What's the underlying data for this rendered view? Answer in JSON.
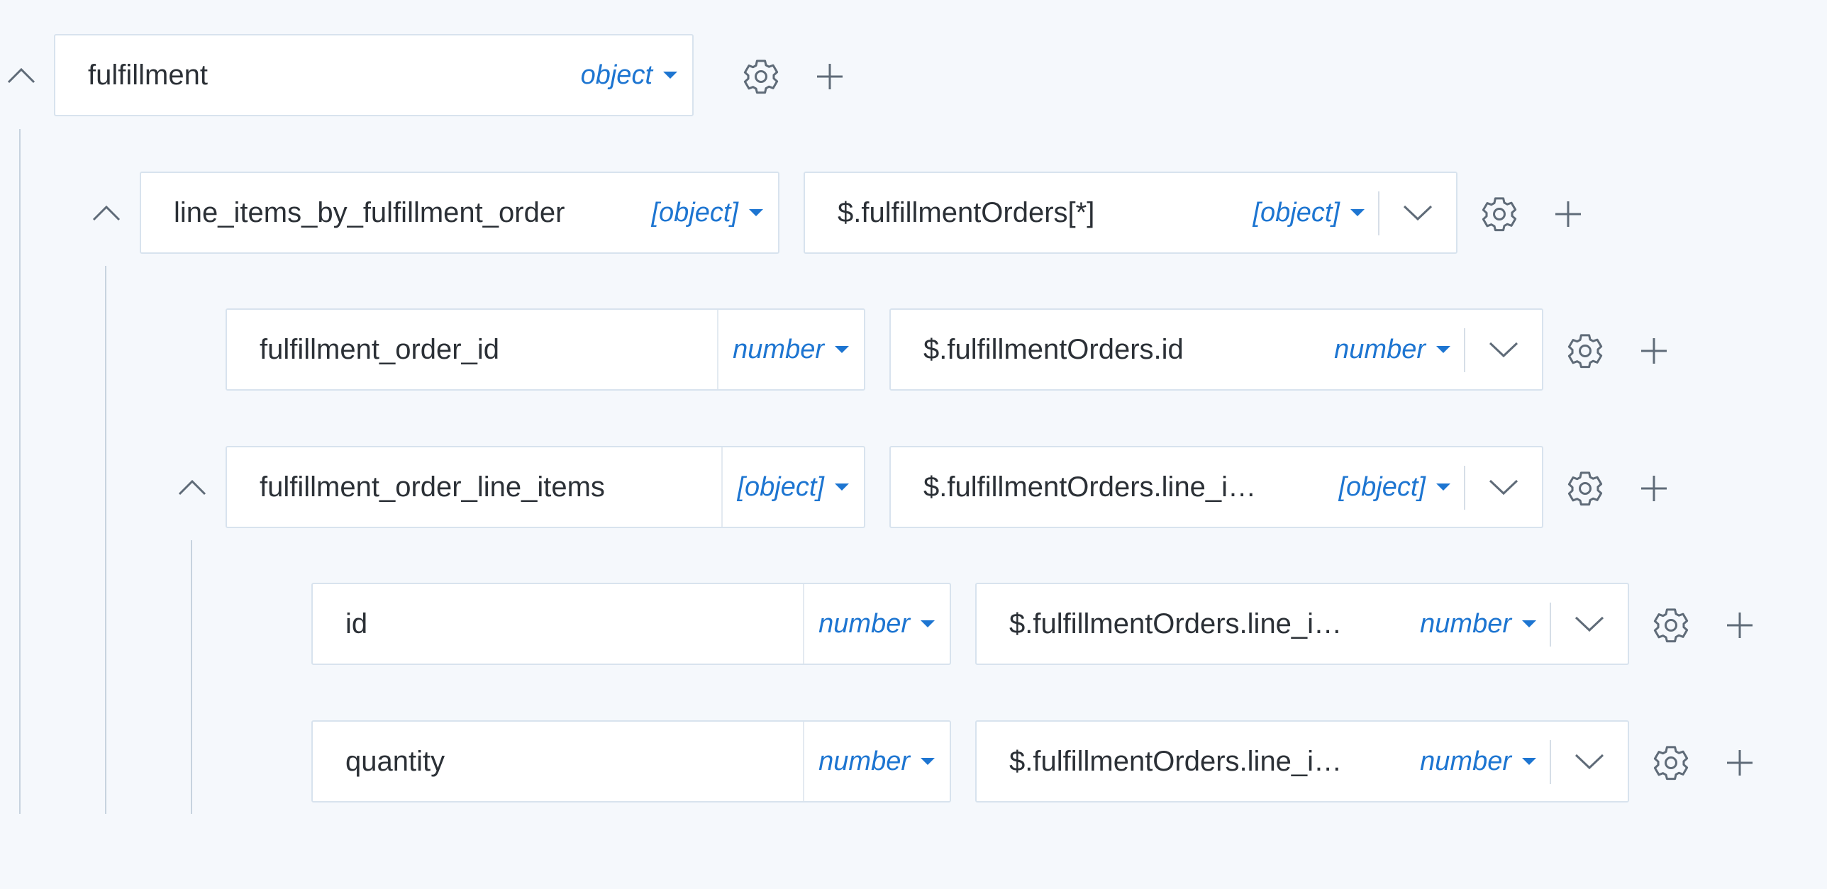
{
  "rows": [
    {
      "name": "fulfillment",
      "type": "object"
    },
    {
      "name": "line_items_by_fulfillment_order",
      "type": "[object]",
      "source_path": "$.fulfillmentOrders[*]",
      "source_type": "[object]"
    },
    {
      "name": "fulfillment_order_id",
      "type": "number",
      "source_path": "$.fulfillmentOrders.id",
      "source_type": "number"
    },
    {
      "name": "fulfillment_order_line_items",
      "type": "[object]",
      "source_path": "$.fulfillmentOrders.line_i…",
      "source_type": "[object]"
    },
    {
      "name": "id",
      "type": "number",
      "source_path": "$.fulfillmentOrders.line_i…",
      "source_type": "number"
    },
    {
      "name": "quantity",
      "type": "number",
      "source_path": "$.fulfillmentOrders.line_i…",
      "source_type": "number"
    }
  ],
  "icons": {
    "collapse": "chevron-up-icon",
    "dropdown": "caret-down-icon",
    "expand": "chevron-down-icon",
    "settings": "gear-icon",
    "add": "plus-icon"
  },
  "colors": {
    "background": "#f5f8fc",
    "accent": "#1d75d1",
    "text": "#2b3036",
    "border": "#d8e3ee",
    "icon": "#5f6b78"
  }
}
